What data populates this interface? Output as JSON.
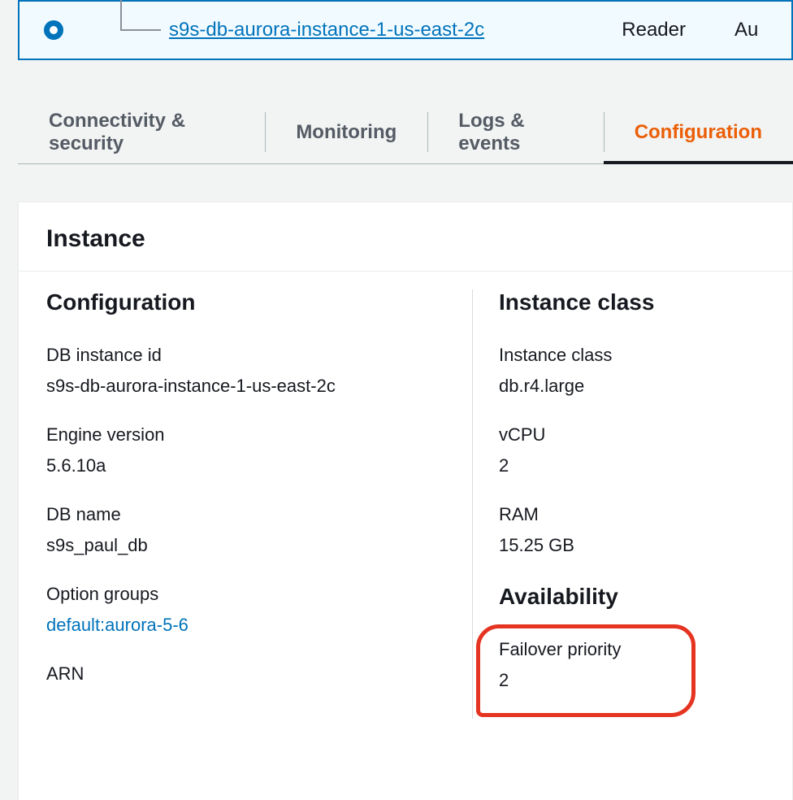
{
  "row": {
    "instance_link": "s9s-db-aurora-instance-1-us-east-2c",
    "role": "Reader",
    "next_col_fragment": "Au"
  },
  "tabs": {
    "connectivity": "Connectivity & security",
    "monitoring": "Monitoring",
    "logs": "Logs & events",
    "configuration": "Configuration"
  },
  "panel": {
    "title": "Instance",
    "left": {
      "heading": "Configuration",
      "db_instance_id": {
        "label": "DB instance id",
        "value": "s9s-db-aurora-instance-1-us-east-2c"
      },
      "engine_version": {
        "label": "Engine version",
        "value": "5.6.10a"
      },
      "db_name": {
        "label": "DB name",
        "value": "s9s_paul_db"
      },
      "option_groups": {
        "label": "Option groups",
        "value": "default:aurora-5-6"
      },
      "arn": {
        "label": "ARN"
      }
    },
    "right": {
      "heading_class": "Instance class",
      "instance_class": {
        "label": "Instance class",
        "value": "db.r4.large"
      },
      "vcpu": {
        "label": "vCPU",
        "value": "2"
      },
      "ram": {
        "label": "RAM",
        "value": "15.25 GB"
      },
      "heading_avail": "Availability",
      "failover_priority": {
        "label": "Failover priority",
        "value": "2"
      }
    }
  }
}
